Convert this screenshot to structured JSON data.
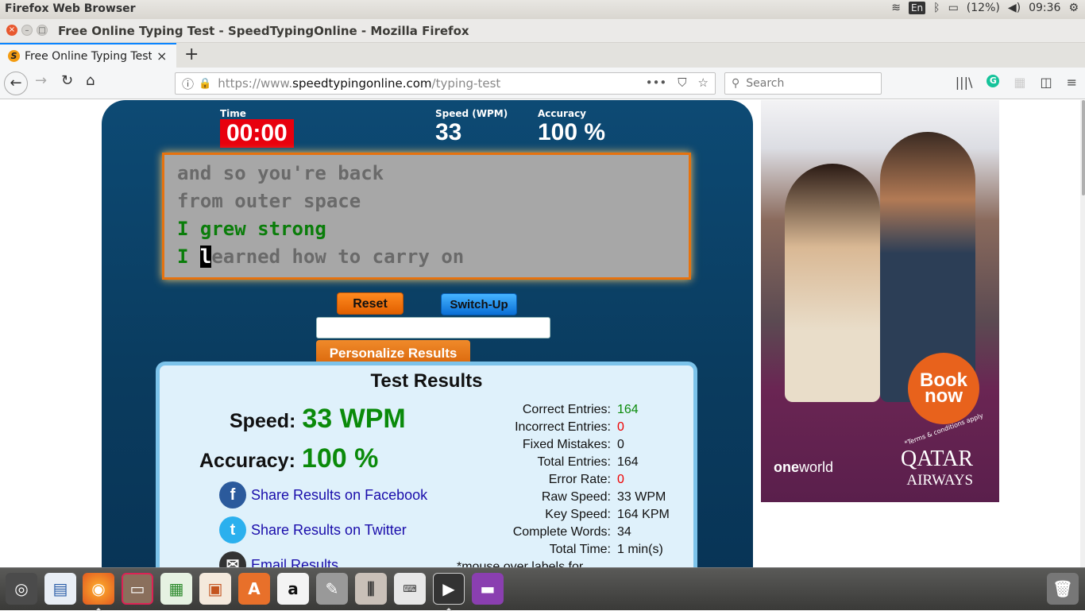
{
  "system": {
    "app_name": "Firefox Web Browser",
    "lang": "En",
    "battery": "(12%)",
    "time": "09:36"
  },
  "window": {
    "title": "Free Online Typing Test - SpeedTypingOnline - Mozilla Firefox"
  },
  "tab": {
    "label": "Free Online Typing Test",
    "favicon": "S"
  },
  "url": {
    "prefix": "https://www.",
    "host": "speedtypingonline.com",
    "path": "/typing-test"
  },
  "search": {
    "placeholder": "Search"
  },
  "test": {
    "time_label": "Time",
    "time_value": "00:00",
    "speed_label": "Speed (WPM)",
    "speed_value": "33",
    "accuracy_label": "Accuracy",
    "accuracy_value": "100 %",
    "lines": [
      {
        "text": "and so you're back"
      },
      {
        "text": "from outer space"
      },
      {
        "text": "I grew strong"
      },
      {
        "done": "I ",
        "cursor": "l",
        "rest": "earned how to carry on"
      }
    ],
    "reset_label": "Reset",
    "switch_label": "Switch-Up",
    "personalize_label": "Personalize Results"
  },
  "results": {
    "title": "Test Results",
    "speed_label": "Speed:",
    "speed_value": "33 WPM",
    "accuracy_label": "Accuracy:",
    "accuracy_value": "100 %",
    "share_facebook": "Share Results on Facebook",
    "share_twitter": "Share Results on Twitter",
    "share_email": "Email Results",
    "details": [
      {
        "label": "Correct Entries:",
        "value": "164",
        "color": "#0a8a0a"
      },
      {
        "label": "Incorrect Entries:",
        "value": "0",
        "color": "#ee0000"
      },
      {
        "label": "Fixed Mistakes:",
        "value": "0",
        "color": "#111111"
      },
      {
        "label": "Total Entries:",
        "value": "164",
        "color": "#111111"
      },
      {
        "label": "Error Rate:",
        "value": "0",
        "color": "#ee0000"
      },
      {
        "label": "Raw Speed:",
        "value": "33 WPM",
        "color": "#111111"
      },
      {
        "label": "Key Speed:",
        "value": "164 KPM",
        "color": "#111111"
      },
      {
        "label": "Complete Words:",
        "value": "34",
        "color": "#111111"
      },
      {
        "label": "Total Time:",
        "value": "1 min(s)",
        "color": "#111111"
      }
    ],
    "note": "*mouse over labels for"
  },
  "ad": {
    "book": "Book",
    "now": "now",
    "terms": "*Terms & conditions apply",
    "oneworld_bold": "one",
    "oneworld_rest": "world",
    "qatar": "QATAR",
    "airways": "AIRWAYS"
  },
  "dock": {
    "icons": [
      "ubuntu-icon",
      "writer-icon",
      "firefox-icon",
      "files-icon",
      "calc-icon",
      "impress-icon",
      "software-center-icon",
      "amazon-icon",
      "settings-icon",
      "mixer-icon",
      "keyboard-icon",
      "video-editor-icon",
      "screen-icon",
      "trash-icon"
    ]
  }
}
